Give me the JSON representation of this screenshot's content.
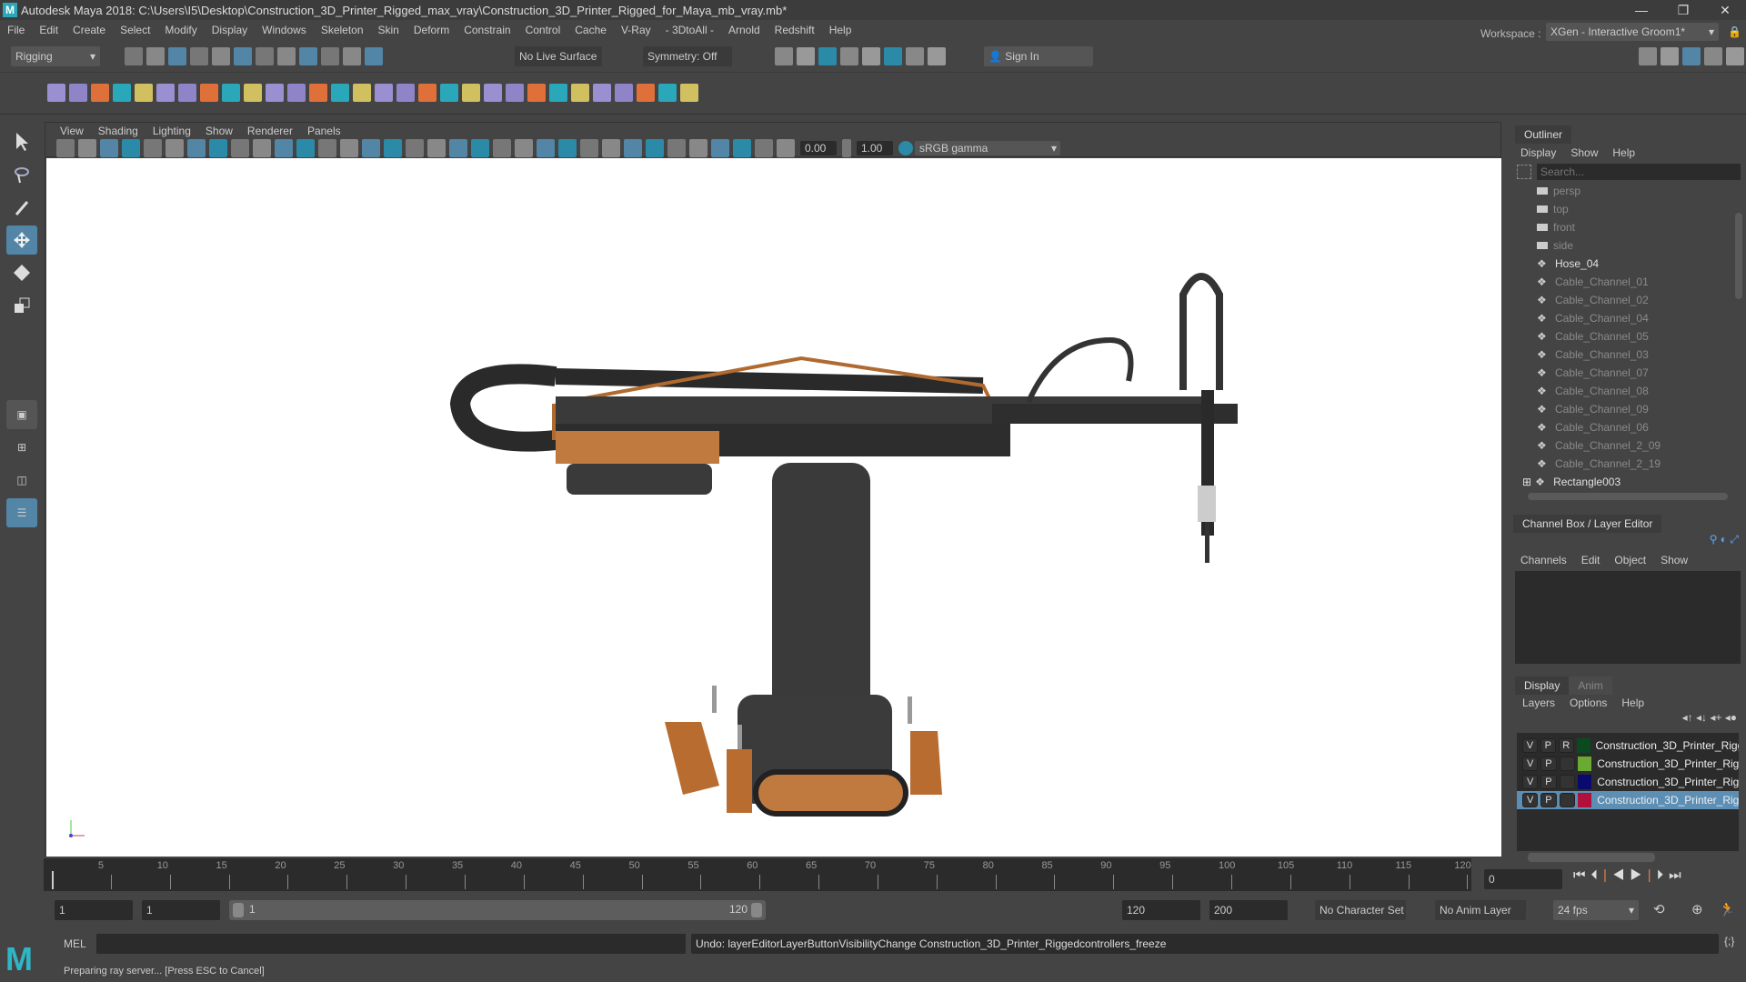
{
  "window": {
    "title": "Autodesk Maya 2018: C:\\Users\\I5\\Desktop\\Construction_3D_Printer_Rigged_max_vray\\Construction_3D_Printer_Rigged_for_Maya_mb_vray.mb*",
    "minimize": "—",
    "restore": "❐",
    "close": "✕"
  },
  "menu": [
    "File",
    "Edit",
    "Create",
    "Select",
    "Modify",
    "Display",
    "Windows",
    "Skeleton",
    "Skin",
    "Deform",
    "Constrain",
    "Control",
    "Cache",
    "V-Ray",
    "- 3DtoAll -",
    "Arnold",
    "Redshift",
    "Help"
  ],
  "status": {
    "mode": "Rigging",
    "live_surface": "No Live Surface",
    "symmetry": "Symmetry: Off",
    "sign_in": "Sign In",
    "workspace_label": "Workspace :",
    "workspace": "XGen - Interactive Groom1*"
  },
  "panel": {
    "menu": [
      "View",
      "Shading",
      "Lighting",
      "Show",
      "Renderer",
      "Panels"
    ],
    "exposure": "0.00",
    "gamma": "1.00",
    "color_space": "sRGB gamma"
  },
  "outliner": {
    "tab": "Outliner",
    "menu": [
      "Display",
      "Show",
      "Help"
    ],
    "search_placeholder": "Search...",
    "items": [
      {
        "label": "persp",
        "type": "camera",
        "dim": true
      },
      {
        "label": "top",
        "type": "camera",
        "dim": true
      },
      {
        "label": "front",
        "type": "camera",
        "dim": true
      },
      {
        "label": "side",
        "type": "camera",
        "dim": true
      },
      {
        "label": "Hose_04",
        "type": "transform",
        "dim": false
      },
      {
        "label": "Cable_Channel_01",
        "type": "transform",
        "dim": true
      },
      {
        "label": "Cable_Channel_02",
        "type": "transform",
        "dim": true
      },
      {
        "label": "Cable_Channel_04",
        "type": "transform",
        "dim": true
      },
      {
        "label": "Cable_Channel_05",
        "type": "transform",
        "dim": true
      },
      {
        "label": "Cable_Channel_03",
        "type": "transform",
        "dim": true
      },
      {
        "label": "Cable_Channel_07",
        "type": "transform",
        "dim": true
      },
      {
        "label": "Cable_Channel_08",
        "type": "transform",
        "dim": true
      },
      {
        "label": "Cable_Channel_09",
        "type": "transform",
        "dim": true
      },
      {
        "label": "Cable_Channel_06",
        "type": "transform",
        "dim": true
      },
      {
        "label": "Cable_Channel_2_09",
        "type": "transform",
        "dim": true
      },
      {
        "label": "Cable_Channel_2_19",
        "type": "transform",
        "dim": true
      },
      {
        "label": "Rectangle003",
        "type": "transform",
        "dim": false,
        "expandable": true
      }
    ]
  },
  "channelbox": {
    "tab": "Channel Box / Layer Editor",
    "menu": [
      "Channels",
      "Edit",
      "Object",
      "Show"
    ]
  },
  "layers": {
    "tabs": [
      "Display",
      "Anim"
    ],
    "menu": [
      "Layers",
      "Options",
      "Help"
    ],
    "rows": [
      {
        "v": "V",
        "p": "P",
        "r": "R",
        "color": "#0b4a1e",
        "name": "Construction_3D_Printer_Rigge",
        "selected": false
      },
      {
        "v": "V",
        "p": "P",
        "r": "",
        "color": "#6aaa32",
        "name": "Construction_3D_Printer_Rigg",
        "selected": false
      },
      {
        "v": "V",
        "p": "P",
        "r": "",
        "color": "#0a0a6e",
        "name": "Construction_3D_Printer_Rigg",
        "selected": false
      },
      {
        "v": "V",
        "p": "P",
        "r": "",
        "color": "#b0103a",
        "name": "Construction_3D_Printer_Rigg",
        "selected": true
      }
    ]
  },
  "timeline": {
    "ticks": [
      "5",
      "10",
      "15",
      "20",
      "25",
      "30",
      "35",
      "40",
      "45",
      "50",
      "55",
      "60",
      "65",
      "70",
      "75",
      "80",
      "85",
      "90",
      "95",
      "100",
      "105",
      "110",
      "115",
      "120"
    ],
    "current_frame": "0"
  },
  "range": {
    "start": "1",
    "playback_start": "1",
    "slider_start": "1",
    "slider_end": "120",
    "playback_end": "120",
    "end": "200",
    "character_set": "No Character Set",
    "anim_layer": "No Anim Layer",
    "fps": "24 fps"
  },
  "command": {
    "lang": "MEL",
    "result": "Undo: layerEditorLayerButtonVisibilityChange Construction_3D_Printer_Riggedcontrollers_freeze"
  },
  "help_line": "Preparing ray server... [Press ESC to Cancel]",
  "colors": {
    "accent": "#5285a6",
    "selected_row": "#5d8fb5",
    "bg": "#444444"
  }
}
